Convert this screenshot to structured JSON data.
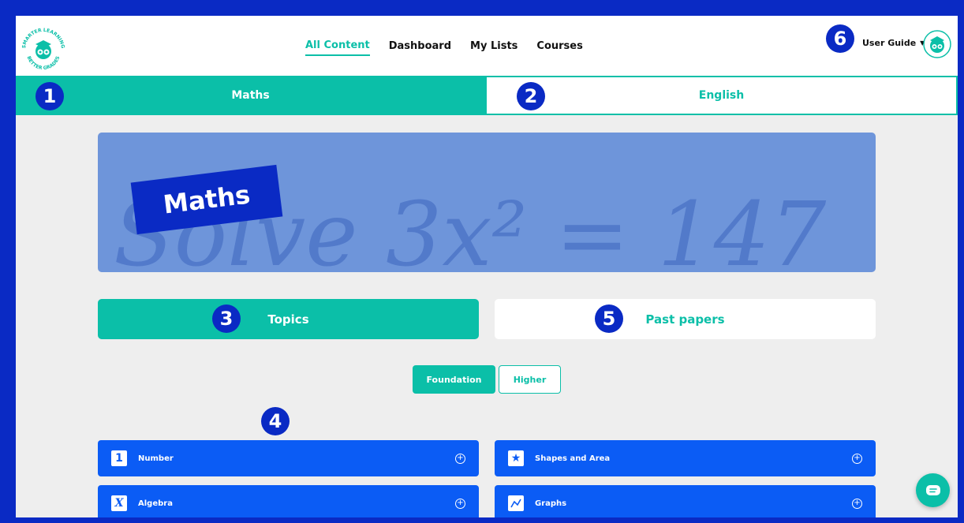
{
  "logo": {
    "top_text": "SMARTER LEARNING",
    "bottom_text": "BETTER GRADES"
  },
  "nav": {
    "items": [
      "All Content",
      "Dashboard",
      "My Lists",
      "Courses"
    ],
    "active_index": 0
  },
  "user_menu": {
    "label": "User Guide"
  },
  "subject_tabs": {
    "maths": "Maths",
    "english": "English"
  },
  "banner": {
    "label": "Maths",
    "background_text": "Solve 3x² = 147"
  },
  "sections": {
    "topics": "Topics",
    "past_papers": "Past papers"
  },
  "levels": {
    "foundation": "Foundation",
    "higher": "Higher"
  },
  "topics": [
    {
      "label": "Number",
      "icon": "number-one-icon",
      "glyph": "1"
    },
    {
      "label": "Shapes and Area",
      "icon": "star-icon",
      "glyph": "★"
    },
    {
      "label": "Algebra",
      "icon": "x-variable-icon",
      "glyph": "X"
    },
    {
      "label": "Graphs",
      "icon": "graph-line-icon",
      "glyph": ""
    }
  ],
  "badges": [
    "1",
    "2",
    "3",
    "4",
    "5",
    "6"
  ],
  "colors": {
    "teal": "#0BBFA8",
    "frame_blue": "#0A2AC4",
    "card_blue": "#0B5CF5",
    "banner_blue": "#6E95DA"
  }
}
